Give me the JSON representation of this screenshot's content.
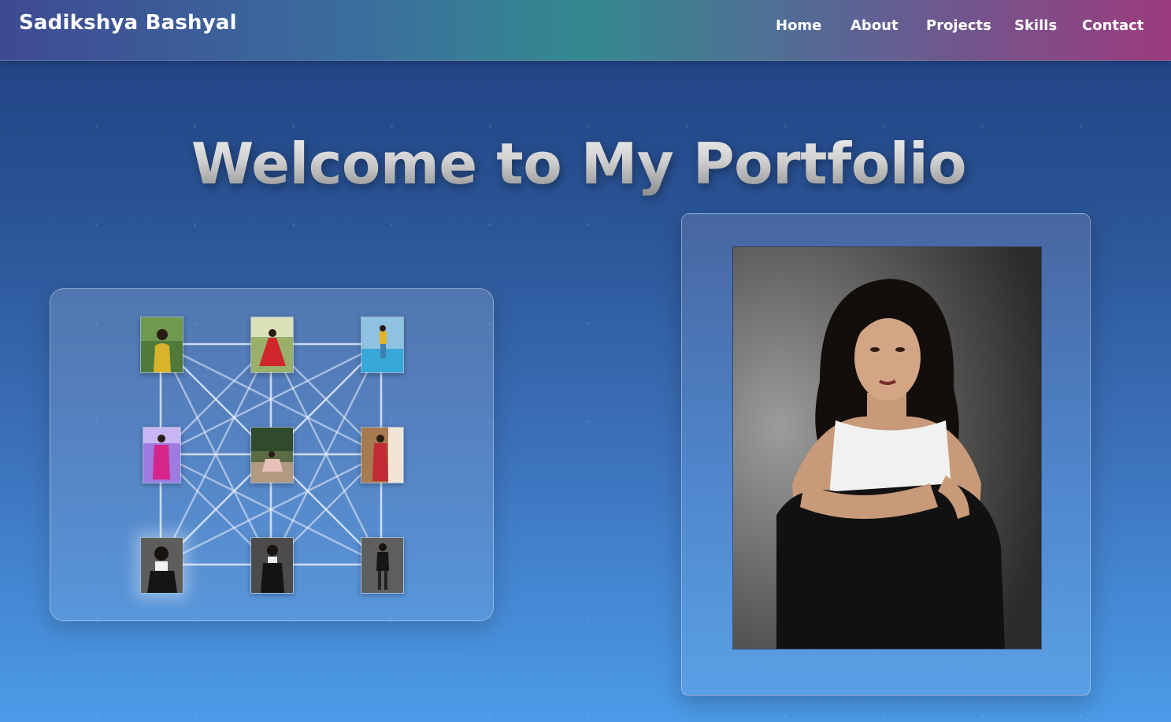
{
  "navbar": {
    "brand": "Sadikshya Bashyal",
    "links": [
      {
        "label": "Home"
      },
      {
        "label": "About"
      },
      {
        "label": "Projects"
      },
      {
        "label": "Skills"
      },
      {
        "label": "Contact"
      }
    ]
  },
  "hero": {
    "title": "Welcome to My Portfolio"
  },
  "gallery": {
    "thumbnails": [
      {
        "subject": "woman in yellow top, green foliage"
      },
      {
        "subject": "woman in red dress, garden"
      },
      {
        "subject": "woman in yellow outfit by pool"
      },
      {
        "subject": "woman in pink suit, purple lights"
      },
      {
        "subject": "woman seated outdoors, trees"
      },
      {
        "subject": "woman in red saree, doorway"
      },
      {
        "subject": "woman in white top, black blazer"
      },
      {
        "subject": "woman in black blazer, standing"
      },
      {
        "subject": "woman in black outfit, full length"
      }
    ],
    "active_index": 6
  },
  "portrait": {
    "subject": "woman with dark curly hair, white top and black blazer, grey studio background"
  },
  "colors": {
    "accent_pink": "#9c3b7d",
    "accent_teal": "#34898f",
    "bg_top": "#1f3f80",
    "bg_bottom": "#4c9be8"
  }
}
